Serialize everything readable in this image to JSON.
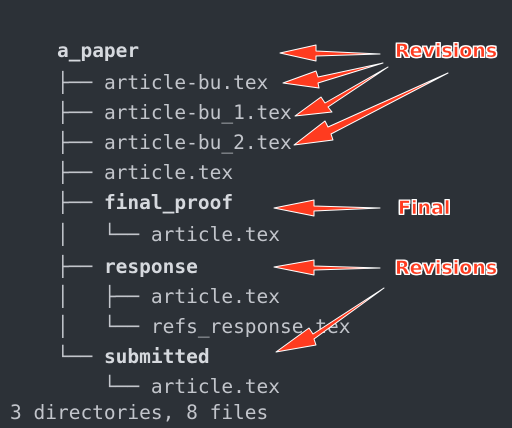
{
  "terminal": {
    "lines": [
      {
        "tree": "",
        "name": "a_paper",
        "kind": "dir"
      },
      {
        "tree": "├── ",
        "name": "article-bu.tex",
        "kind": "file"
      },
      {
        "tree": "├── ",
        "name": "article-bu_1.tex",
        "kind": "file"
      },
      {
        "tree": "├── ",
        "name": "article-bu_2.tex",
        "kind": "file"
      },
      {
        "tree": "├── ",
        "name": "article.tex",
        "kind": "file"
      },
      {
        "tree": "├── ",
        "name": "final_proof",
        "kind": "dir"
      },
      {
        "tree": "│   └── ",
        "name": "article.tex",
        "kind": "file"
      },
      {
        "tree": "├── ",
        "name": "response",
        "kind": "dir"
      },
      {
        "tree": "│   ├── ",
        "name": "article.tex",
        "kind": "file"
      },
      {
        "tree": "│   └── ",
        "name": "refs_response.tex",
        "kind": "file"
      },
      {
        "tree": "└── ",
        "name": "submitted",
        "kind": "dir"
      },
      {
        "tree": "    └── ",
        "name": "article.tex",
        "kind": "file"
      }
    ],
    "summary": "3 directories, 8 files"
  },
  "annotations": {
    "revisions_top": "Revisions",
    "final": "Final",
    "revisions_bottom": "Revisions",
    "color": "#ff3b1f"
  }
}
